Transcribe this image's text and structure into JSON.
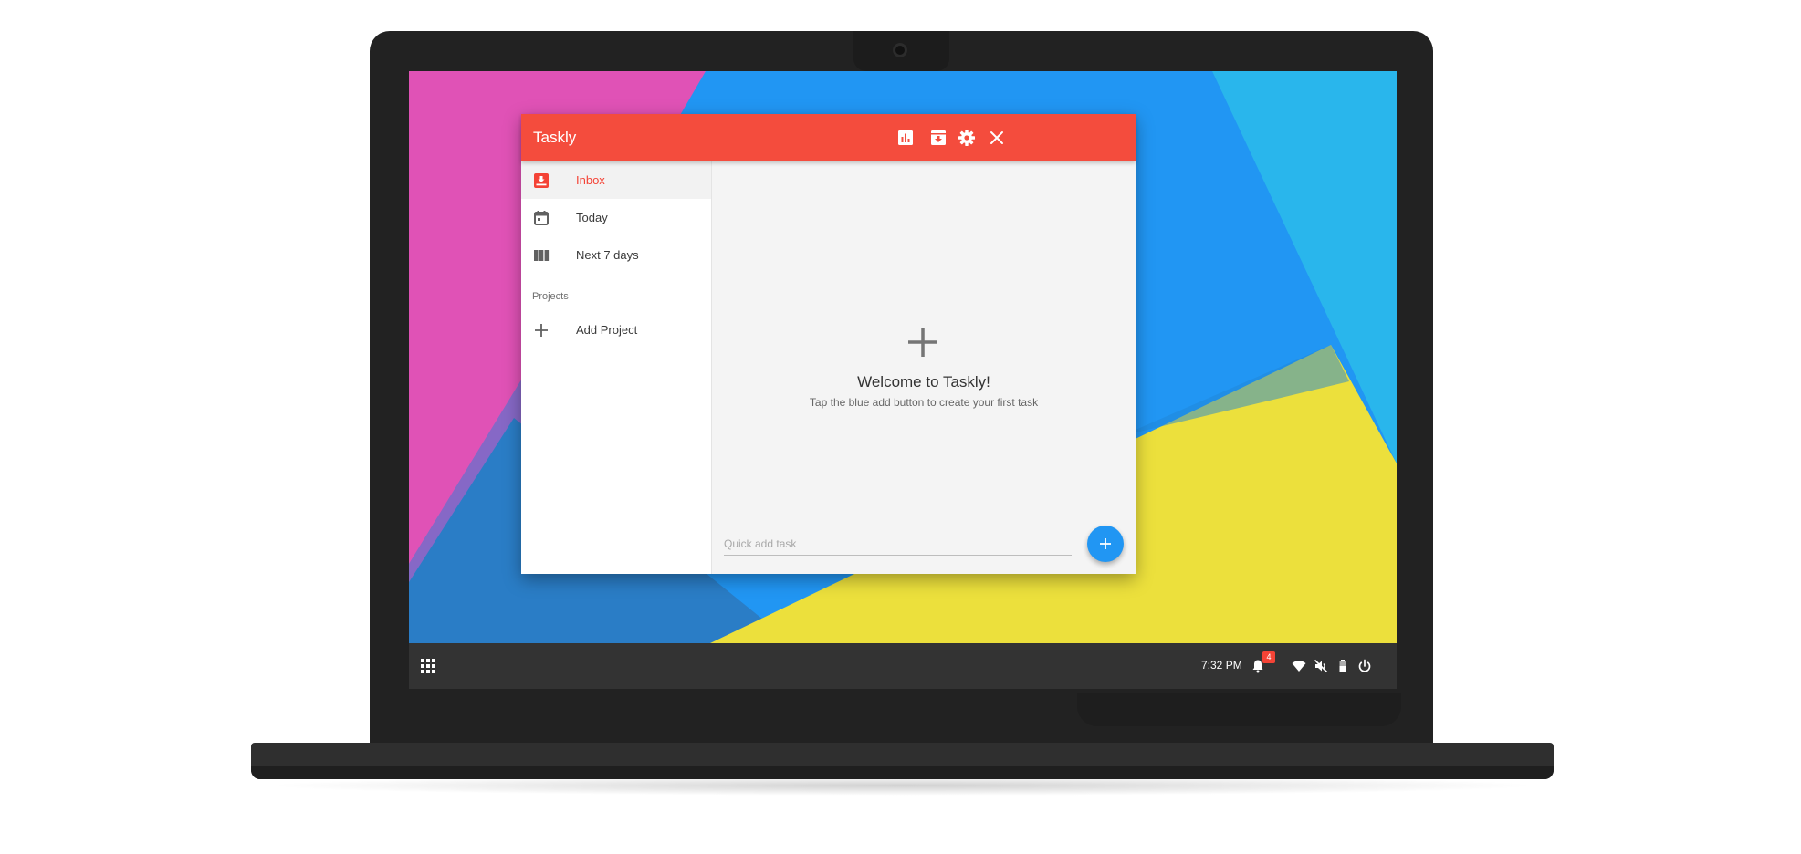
{
  "window": {
    "title": "Taskly",
    "toolbar_icons": [
      "bar-chart-icon",
      "archive-icon",
      "settings-icon",
      "close-icon"
    ]
  },
  "sidebar": {
    "items": [
      {
        "label": "Inbox",
        "icon": "inbox-icon",
        "active": true
      },
      {
        "label": "Today",
        "icon": "calendar-icon",
        "active": false
      },
      {
        "label": "Next 7 days",
        "icon": "week-columns-icon",
        "active": false
      }
    ],
    "section_label": "Projects",
    "add_project_label": "Add Project"
  },
  "main": {
    "welcome_title": "Welcome to Taskly!",
    "welcome_subtitle": "Tap the blue add button to create your first task",
    "quick_add_placeholder": "Quick add task"
  },
  "taskbar": {
    "time": "7:32 PM",
    "notification_count": "4",
    "tray_icons": [
      "app-launcher-icon",
      "notifications-icon",
      "wifi-icon",
      "volume-muted-icon",
      "battery-icon",
      "power-icon"
    ]
  },
  "colors": {
    "titlebar": "#f44c3d",
    "accent_red": "#f44336",
    "fab_blue": "#2196f3",
    "wallpaper_pink": "#e052b6",
    "wallpaper_blue": "#2196f3",
    "wallpaper_light_blue": "#29b6ec",
    "wallpaper_yellow": "#ece03c",
    "wallpaper_dark_blue": "#2a7dc6",
    "taskbar": "#333333"
  }
}
